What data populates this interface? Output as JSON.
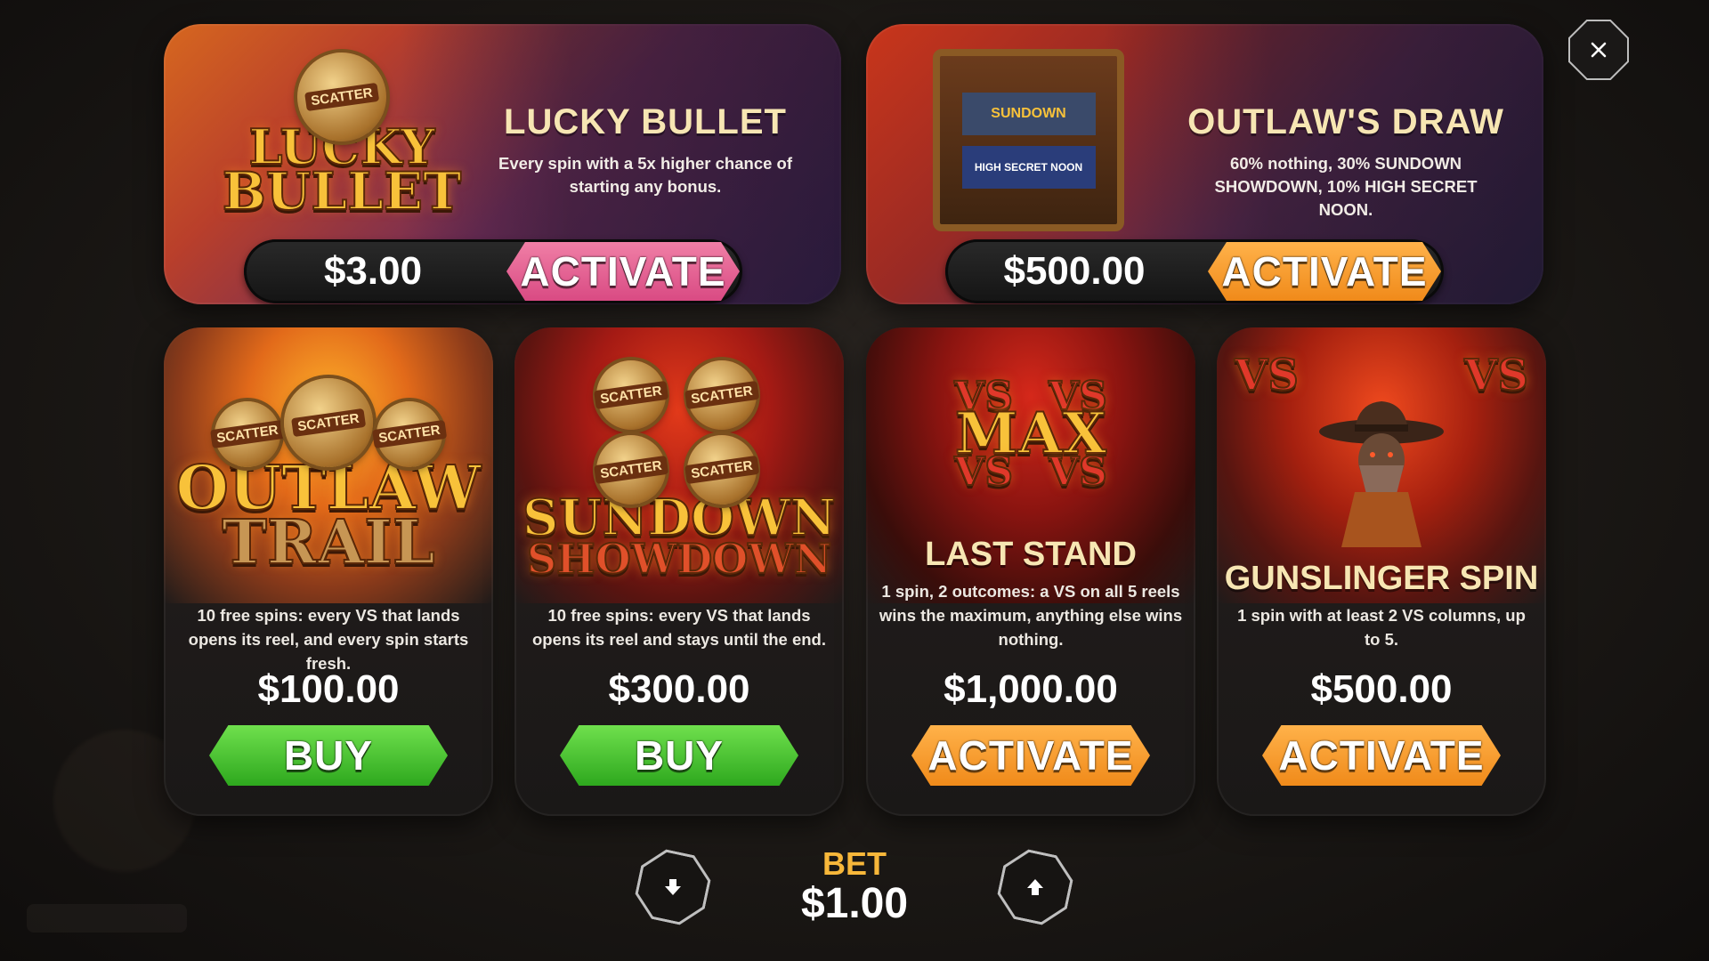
{
  "cards_wide": [
    {
      "title": "LUCKY BULLET",
      "description": "Every spin with a 5x higher chance of starting any bonus.",
      "price": "$3.00",
      "button": "ACTIVATE",
      "art": {
        "badge": "SCATTER",
        "logo_line1": "LUCKY",
        "logo_line2": "BULLET"
      }
    },
    {
      "title": "OUTLAW'S DRAW",
      "description": "60% nothing, 30% SUNDOWN SHOWDOWN, 10% HIGH SECRET NOON.",
      "price": "$500.00",
      "button": "ACTIVATE",
      "art": {
        "reel_top": "SUNDOWN",
        "reel_bottom": "HIGH SECRET NOON"
      }
    }
  ],
  "cards_small": [
    {
      "title": "",
      "description": "10 free spins: every VS that lands opens its reel, and every spin starts fresh.",
      "price": "$100.00",
      "button": "BUY",
      "art": {
        "badges": [
          "SCATTER",
          "SCATTER",
          "SCATTER"
        ],
        "logo_line1": "OUTLAW",
        "logo_line2": "TRAIL"
      }
    },
    {
      "title": "",
      "description": "10 free spins: every VS that lands opens its reel and stays until the end.",
      "price": "$300.00",
      "button": "BUY",
      "art": {
        "badges": [
          "SCATTER",
          "SCATTER",
          "SCATTER",
          "SCATTER"
        ],
        "logo_line1": "SUNDOWN",
        "logo_line2": "SHOWDOWN"
      }
    },
    {
      "title": "LAST STAND",
      "description": "1 spin, 2 outcomes: a VS on all 5 reels wins the maximum, anything else wins nothing.",
      "price": "$1,000.00",
      "button": "ACTIVATE",
      "art": {
        "vs": "VS",
        "max": "MAX"
      }
    },
    {
      "title": "GUNSLINGER SPIN",
      "description": "1 spin with at least 2 VS columns, up to 5.",
      "price": "$500.00",
      "button": "ACTIVATE",
      "art": {
        "vs": "VS"
      }
    }
  ],
  "bet": {
    "label": "BET",
    "value": "$1.00"
  },
  "icons": {
    "close": "close-icon",
    "decrease": "arrow-down-icon",
    "increase": "arrow-up-icon"
  },
  "colors": {
    "accent_gold": "#f7b73a",
    "title_cream": "#f7e6b3",
    "btn_pink": "#e45f92",
    "btn_orange": "#f59a2a",
    "btn_green": "#46c22e"
  }
}
